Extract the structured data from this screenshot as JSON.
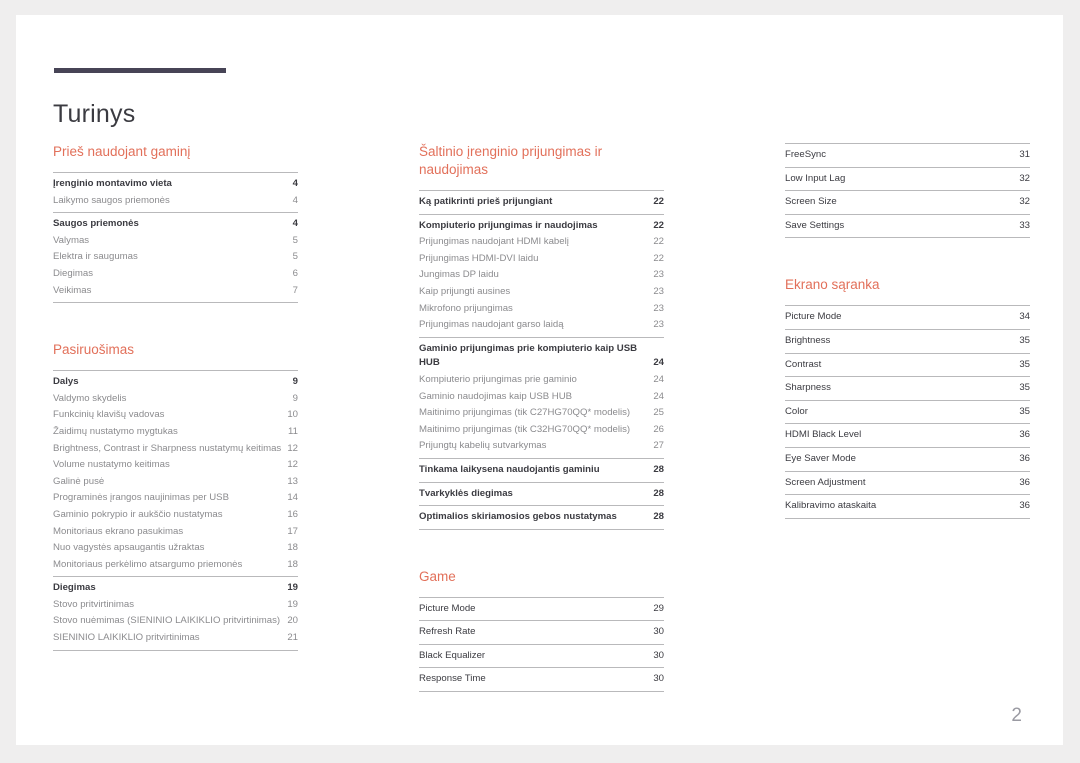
{
  "document": {
    "title": "Turinys",
    "page_number": "2",
    "accent_color": "#e2705a",
    "rule_color": "#474456"
  },
  "columns": [
    {
      "id": "column-1",
      "sections": [
        {
          "heading": "Prieš naudojant gaminį",
          "blocks": [
            {
              "entries": [
                {
                  "label": "Įrenginio montavimo vieta",
                  "page": "4",
                  "level": 1
                },
                {
                  "label": "Laikymo saugos priemonės",
                  "page": "4",
                  "level": 2
                }
              ]
            },
            {
              "entries": [
                {
                  "label": "Saugos priemonės",
                  "page": "4",
                  "level": 1
                },
                {
                  "label": "Valymas",
                  "page": "5",
                  "level": 2
                },
                {
                  "label": "Elektra ir saugumas",
                  "page": "5",
                  "level": 2
                },
                {
                  "label": "Diegimas",
                  "page": "6",
                  "level": 2
                },
                {
                  "label": "Veikimas",
                  "page": "7",
                  "level": 2
                }
              ]
            }
          ]
        },
        {
          "heading": "Pasiruošimas",
          "blocks": [
            {
              "entries": [
                {
                  "label": "Dalys",
                  "page": "9",
                  "level": 1
                },
                {
                  "label": "Valdymo skydelis",
                  "page": "9",
                  "level": 2
                },
                {
                  "label": "Funkcinių klavišų vadovas",
                  "page": "10",
                  "level": 2
                },
                {
                  "label": "Žaidimų nustatymo mygtukas",
                  "page": "11",
                  "level": 2
                },
                {
                  "label": "Brightness, Contrast ir Sharpness nustatymų keitimas",
                  "page": "12",
                  "level": 2
                },
                {
                  "label": "Volume nustatymo keitimas",
                  "page": "12",
                  "level": 2
                },
                {
                  "label": "Galinė pusė",
                  "page": "13",
                  "level": 2
                },
                {
                  "label": "Programinės įrangos naujinimas per USB",
                  "page": "14",
                  "level": 2
                },
                {
                  "label": "Gaminio pokrypio ir aukščio nustatymas",
                  "page": "16",
                  "level": 2
                },
                {
                  "label": "Monitoriaus ekrano pasukimas",
                  "page": "17",
                  "level": 2
                },
                {
                  "label": "Nuo vagystės apsaugantis užraktas",
                  "page": "18",
                  "level": 2
                },
                {
                  "label": "Monitoriaus perkėlimo atsargumo priemonės",
                  "page": "18",
                  "level": 2
                }
              ]
            },
            {
              "entries": [
                {
                  "label": "Diegimas",
                  "page": "19",
                  "level": 1
                },
                {
                  "label": "Stovo pritvirtinimas",
                  "page": "19",
                  "level": 2
                },
                {
                  "label": "Stovo nuėmimas (SIENINIO LAIKIKLIO pritvirtinimas)",
                  "page": "20",
                  "level": 2
                },
                {
                  "label": "SIENINIO LAIKIKLIO pritvirtinimas",
                  "page": "21",
                  "level": 2
                }
              ]
            }
          ]
        }
      ]
    },
    {
      "id": "column-2",
      "sections": [
        {
          "heading": "Šaltinio įrenginio prijungimas ir naudojimas",
          "blocks": [
            {
              "entries": [
                {
                  "label": "Ką patikrinti prieš prijungiant",
                  "page": "22",
                  "level": 1
                }
              ]
            },
            {
              "entries": [
                {
                  "label": "Kompiuterio prijungimas ir naudojimas",
                  "page": "22",
                  "level": 1
                },
                {
                  "label": "Prijungimas naudojant HDMI kabelį",
                  "page": "22",
                  "level": 2
                },
                {
                  "label": "Prijungimas HDMI-DVI laidu",
                  "page": "22",
                  "level": 2
                },
                {
                  "label": "Jungimas DP laidu",
                  "page": "23",
                  "level": 2
                },
                {
                  "label": "Kaip prijungti ausines",
                  "page": "23",
                  "level": 2
                },
                {
                  "label": "Mikrofono prijungimas",
                  "page": "23",
                  "level": 2
                },
                {
                  "label": "Prijungimas naudojant garso laidą",
                  "page": "23",
                  "level": 2
                }
              ]
            },
            {
              "entries": [
                {
                  "label": "Gaminio prijungimas prie kompiuterio kaip USB HUB",
                  "page": "24",
                  "level": 1
                },
                {
                  "label": "Kompiuterio prijungimas prie gaminio",
                  "page": "24",
                  "level": 2
                },
                {
                  "label": "Gaminio naudojimas kaip USB HUB",
                  "page": "24",
                  "level": 2
                },
                {
                  "label": "Maitinimo prijungimas (tik C27HG70QQ* modelis)",
                  "page": "25",
                  "level": 2,
                  "tight": true
                },
                {
                  "label": "Maitinimo prijungimas (tik C32HG70QQ* modelis)",
                  "page": "26",
                  "level": 2,
                  "tight": true
                },
                {
                  "label": "Prijungtų kabelių sutvarkymas",
                  "page": "27",
                  "level": 2
                }
              ]
            },
            {
              "entries": [
                {
                  "label": "Tinkama laikysena naudojantis gaminiu",
                  "page": "28",
                  "level": 1
                }
              ]
            },
            {
              "entries": [
                {
                  "label": "Tvarkyklės diegimas",
                  "page": "28",
                  "level": 1
                }
              ]
            },
            {
              "entries": [
                {
                  "label": "Optimalios skiriamosios gebos nustatymas",
                  "page": "28",
                  "level": 1
                }
              ]
            }
          ]
        },
        {
          "heading": "Game",
          "blocks": [
            {
              "entries": [
                {
                  "label": "Picture Mode",
                  "page": "29",
                  "level": 3
                }
              ]
            },
            {
              "entries": [
                {
                  "label": "Refresh Rate",
                  "page": "30",
                  "level": 3
                }
              ]
            },
            {
              "entries": [
                {
                  "label": "Black Equalizer",
                  "page": "30",
                  "level": 3
                }
              ]
            },
            {
              "entries": [
                {
                  "label": "Response Time",
                  "page": "30",
                  "level": 3
                }
              ]
            }
          ]
        }
      ]
    },
    {
      "id": "column-3",
      "sections": [
        {
          "heading": "",
          "blocks": [
            {
              "entries": [
                {
                  "label": "FreeSync",
                  "page": "31",
                  "level": 3
                }
              ]
            },
            {
              "entries": [
                {
                  "label": "Low Input Lag",
                  "page": "32",
                  "level": 3
                }
              ]
            },
            {
              "entries": [
                {
                  "label": "Screen Size",
                  "page": "32",
                  "level": 3
                }
              ]
            },
            {
              "entries": [
                {
                  "label": "Save Settings",
                  "page": "33",
                  "level": 3
                }
              ]
            }
          ]
        },
        {
          "heading": "Ekrano sąranka",
          "blocks": [
            {
              "entries": [
                {
                  "label": "Picture Mode",
                  "page": "34",
                  "level": 3
                }
              ]
            },
            {
              "entries": [
                {
                  "label": "Brightness",
                  "page": "35",
                  "level": 3
                }
              ]
            },
            {
              "entries": [
                {
                  "label": "Contrast",
                  "page": "35",
                  "level": 3
                }
              ]
            },
            {
              "entries": [
                {
                  "label": "Sharpness",
                  "page": "35",
                  "level": 3
                }
              ]
            },
            {
              "entries": [
                {
                  "label": "Color",
                  "page": "35",
                  "level": 3
                }
              ]
            },
            {
              "entries": [
                {
                  "label": "HDMI Black Level",
                  "page": "36",
                  "level": 3
                }
              ]
            },
            {
              "entries": [
                {
                  "label": "Eye Saver Mode",
                  "page": "36",
                  "level": 3
                }
              ]
            },
            {
              "entries": [
                {
                  "label": "Screen Adjustment",
                  "page": "36",
                  "level": 3
                }
              ]
            },
            {
              "entries": [
                {
                  "label": "Kalibravimo ataskaita",
                  "page": "36",
                  "level": 3
                }
              ]
            }
          ]
        }
      ]
    }
  ]
}
